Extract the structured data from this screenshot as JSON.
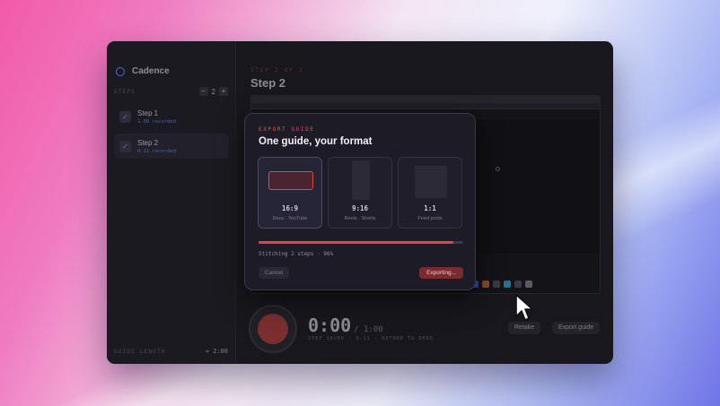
{
  "app": {
    "name": "Cadence"
  },
  "window": {
    "traffic_colors": [
      "#ff5f57",
      "#febc2e",
      "#28c840"
    ]
  },
  "sidebar": {
    "steps_label": "STEPS",
    "step_count": "2",
    "minus_label": "−",
    "plus_label": "+",
    "items": [
      {
        "title": "Step 1",
        "meta": "1.08 recorded",
        "check": "✓"
      },
      {
        "title": "Step 2",
        "meta": "0:11 recorded",
        "check": "✓"
      }
    ],
    "guide_length_label": "GUIDE LENGTH",
    "guide_length_value": "≈ 2:00"
  },
  "main": {
    "kicker": "STEP 2 OF 2",
    "title": "Step 2",
    "timer_value": "0:00",
    "timer_total": "/ 1:00",
    "timer_hint": "STEP SAVED · 0:11 · RETAKE TO REDO",
    "retake_label": "Retake",
    "export_guide_label": "Export guide"
  },
  "modal": {
    "kicker": "EXPORT GUIDE",
    "title": "One guide, your format",
    "formats": [
      {
        "ratio": "16:9",
        "use": "Docs · YouTube",
        "selected": true
      },
      {
        "ratio": "9:16",
        "use": "Reels · Shorts",
        "selected": false
      },
      {
        "ratio": "1:1",
        "use": "Feed posts",
        "selected": false
      }
    ],
    "progress": 0.95,
    "progress_label": "Stitching 2 steps · 96%",
    "cancel_label": "Cancel",
    "export_label": "Exporting..."
  },
  "colors": {
    "accent": "#e8443f",
    "brand": "#5b5fd3"
  }
}
